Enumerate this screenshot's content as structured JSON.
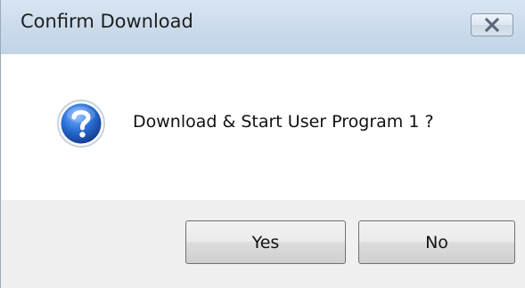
{
  "window": {
    "title": "Confirm Download",
    "close_icon": "close-icon"
  },
  "dialog": {
    "icon": "question-icon",
    "message": "Download & Start User Program 1 ?"
  },
  "buttons": {
    "yes_label": "Yes",
    "no_label": "No"
  },
  "colors": {
    "titlebar": "#cddcec",
    "content_background": "#ffffff",
    "footer_background": "#f0f0f0",
    "icon_blue": "#1f5fc4"
  }
}
